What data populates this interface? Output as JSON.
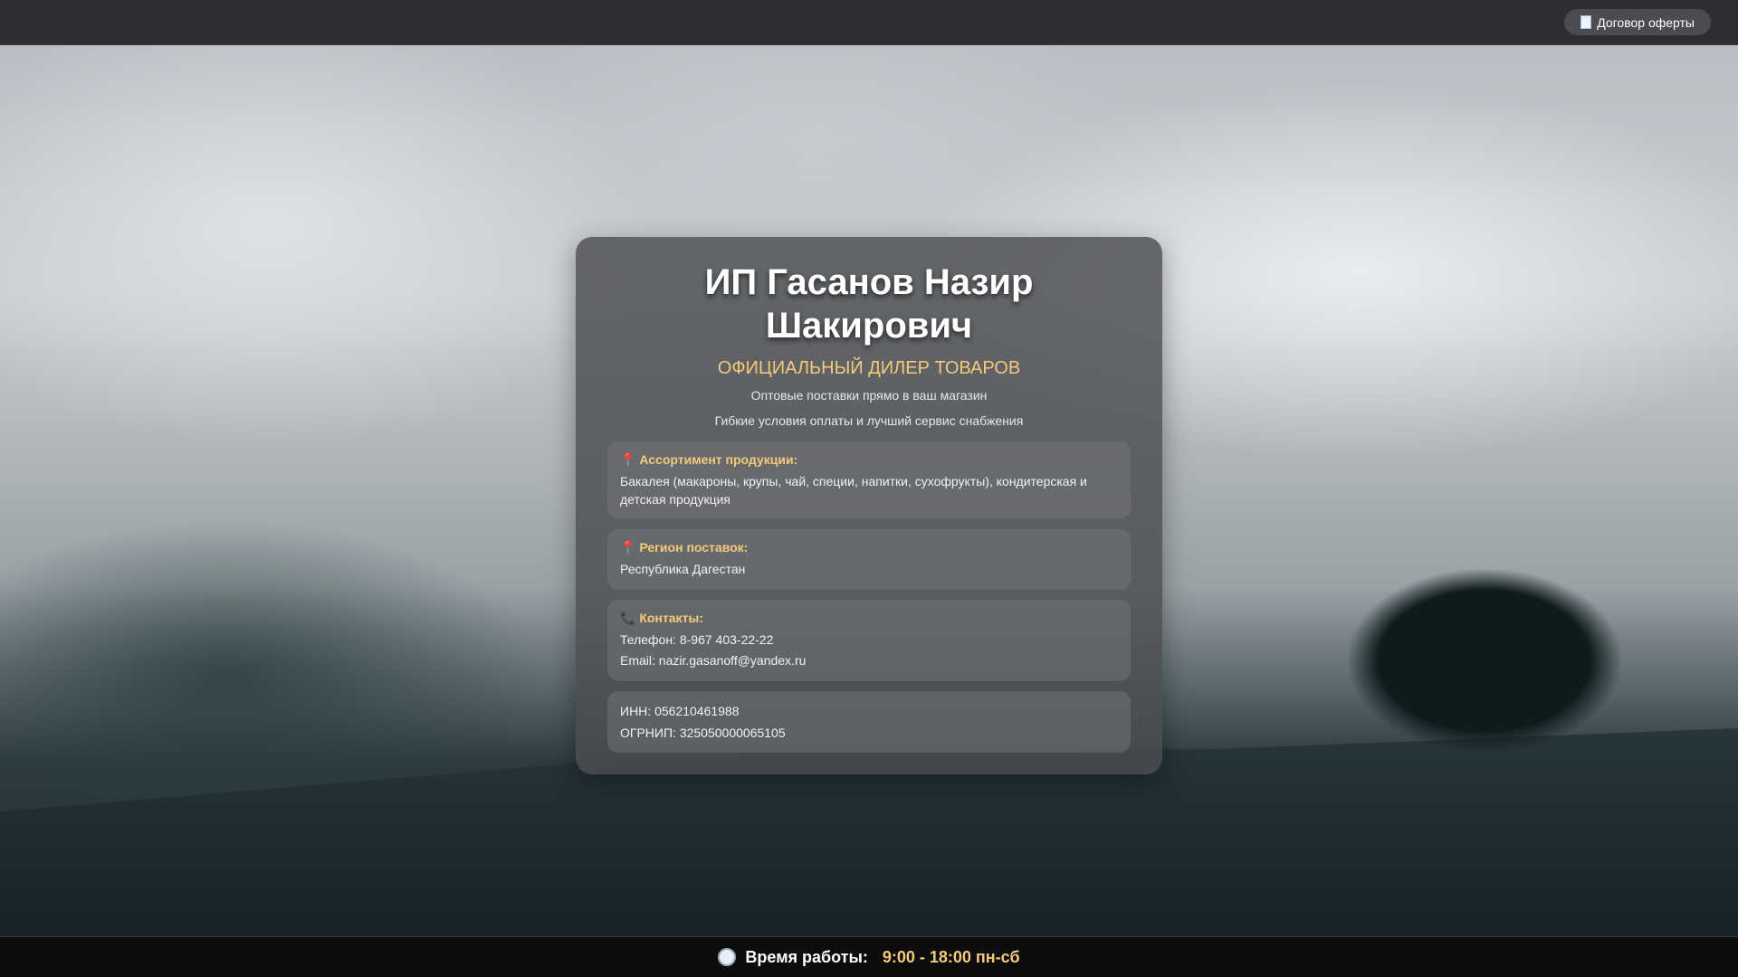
{
  "topbar": {
    "offer_button": "Договор оферты"
  },
  "card": {
    "title_line1": "ИП Гасанов Назир",
    "title_line2": "Шакирович",
    "subtitle": "ОФИЦИАЛЬНЫЙ ДИЛЕР ТОВАРОВ",
    "tagline1": "Оптовые поставки прямо в ваш магазин",
    "tagline2": "Гибкие условия оплаты и лучший сервис снабжения",
    "assortment": {
      "heading": "Ассортимент продукции:",
      "text": "Бакалея (макароны, крупы, чай, специи, напитки, сухофрукты), кондитерская и детская продукция"
    },
    "region": {
      "heading": "Регион поставок:",
      "text": "Республика Дагестан"
    },
    "contacts": {
      "heading": "Контакты:",
      "phone": "Телефон: 8-967 403-22-22",
      "email": "Email: nazir.gasanoff@yandex.ru"
    },
    "legal": {
      "inn": "ИНН: 056210461988",
      "ogrnip": "ОГРНИП: 325050000065105"
    }
  },
  "footer": {
    "label": "Время работы:",
    "hours": "9:00 - 18:00 пн-сб"
  }
}
